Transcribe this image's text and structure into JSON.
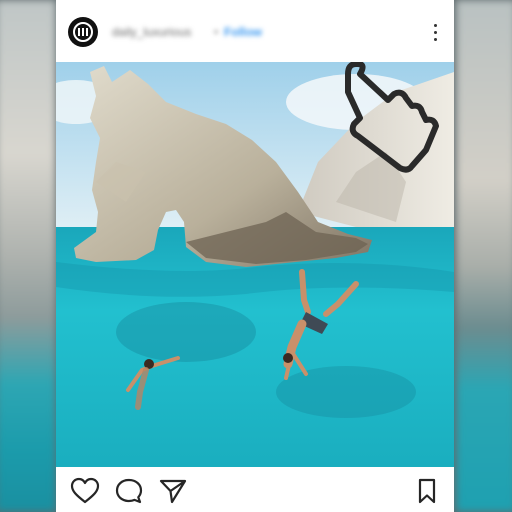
{
  "post": {
    "username": "daily_luxurious",
    "separator": "•",
    "follow_label": "Follow"
  },
  "icons": {
    "avatar": "brand-logo",
    "menu": "more-options-icon",
    "like": "heart-icon",
    "comment": "comment-icon",
    "share": "send-icon",
    "save": "bookmark-icon",
    "overlay": "pointing-hand-icon"
  },
  "colors": {
    "water": "#1fb8c8",
    "follow_link": "#3897f0",
    "icon_stroke": "#262626"
  }
}
